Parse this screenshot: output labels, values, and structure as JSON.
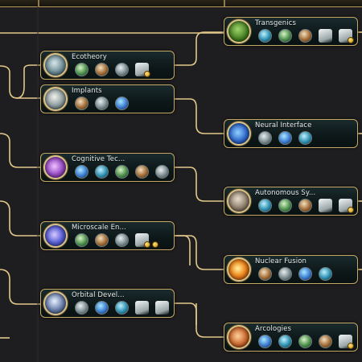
{
  "palette": {
    "background": "#1e1d1f",
    "connector": "#e2c88a",
    "card_border": "#c6a866",
    "gold": "#e0b431"
  },
  "technologies": [
    {
      "id": "transgenics",
      "name": "Transgenics",
      "emblem_icon": "dna-plant-icon",
      "unlocks": [
        "terraform-plant-icon",
        "bio-creature-icon",
        "alien-fruit-icon",
        "skeleton-icon",
        "machine-pod-icon"
      ],
      "affinity_badges": 1
    },
    {
      "id": "ecotheory",
      "name": "Ecotheory",
      "emblem_icon": "ecology-dome-icon",
      "unlocks": [
        "forest-icon",
        "rock-crater-icon",
        "biosphere-icon",
        "flower-icon"
      ],
      "affinity_badges": 1
    },
    {
      "id": "implants",
      "name": "Implants",
      "emblem_icon": "medical-drone-icon",
      "unlocks": [
        "green-organism-icon",
        "herb-icon",
        "hologram-icon"
      ],
      "affinity_badges": 0
    },
    {
      "id": "neural-interface",
      "name": "Neural Interface",
      "emblem_icon": "neural-net-icon",
      "unlocks": [
        "satellite-dish-icon",
        "neuron-icon",
        "server-icon"
      ],
      "affinity_badges": 0
    },
    {
      "id": "cognitive-tech",
      "name": "Cognitive Tec...",
      "emblem_icon": "brain-web-icon",
      "unlocks": [
        "circuit-icon",
        "mech-unit-icon",
        "tower-icon",
        "data-core-icon",
        "crystal-icon"
      ],
      "affinity_badges": 0
    },
    {
      "id": "autonomous-systems",
      "name": "Autonomous Sy...",
      "emblem_icon": "rover-icon",
      "unlocks": [
        "tank-icon",
        "reactor-icon",
        "hover-vehicle-icon",
        "drop-arrow-icon",
        "miner-drone-icon"
      ],
      "affinity_badges": 1
    },
    {
      "id": "microscale-engineering",
      "name": "Microscale En...",
      "emblem_icon": "particle-beam-icon",
      "unlocks": [
        "walker-icon",
        "nanobot-icon",
        "dark-structure-icon",
        "spire-icon"
      ],
      "affinity_badges": 2
    },
    {
      "id": "nuclear-fusion",
      "name": "Nuclear Fusion",
      "emblem_icon": "fusion-fire-icon",
      "unlocks": [
        "power-plant-icon",
        "fusion-core-icon",
        "bunker-icon",
        "shield-orb-icon"
      ],
      "affinity_badges": 0
    },
    {
      "id": "orbital-development",
      "name": "Orbital Devel...",
      "emblem_icon": "orbital-ship-icon",
      "unlocks": [
        "solar-array-icon",
        "launch-site-icon",
        "laser-web-icon",
        "satellite-icon",
        "drone-cluster-icon"
      ],
      "affinity_badges": 0
    },
    {
      "id": "arcologies",
      "name": "Arcologies",
      "emblem_icon": "desert-city-icon",
      "unlocks": [
        "rover-unit-icon",
        "navigation-icon",
        "mountain-icon",
        "waypoint-icon",
        "orbital-ring-icon"
      ],
      "affinity_badges": 1
    }
  ]
}
